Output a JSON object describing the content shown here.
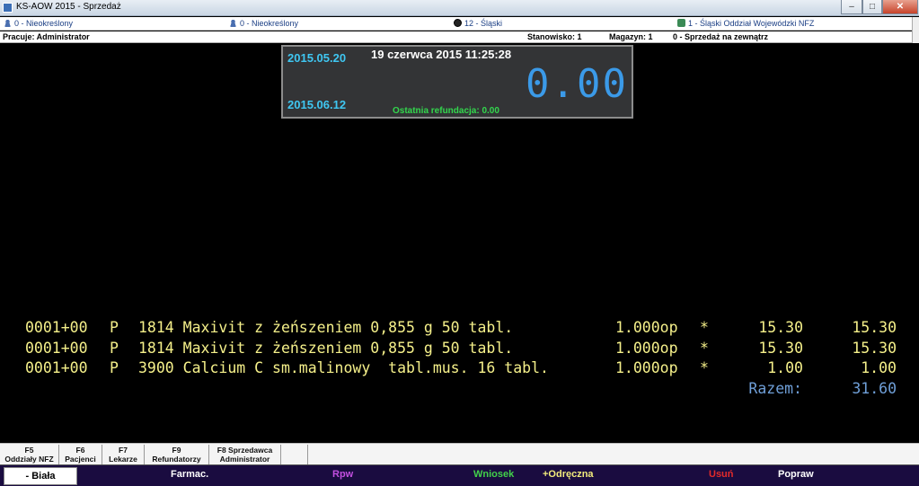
{
  "window": {
    "title": "KS-AOW 2015 - Sprzedaż",
    "minimize": "–",
    "maximize": "□",
    "close": "✕"
  },
  "info1": {
    "patient": "0 - Nieokreślony",
    "doctor": "0 - Nieokreślony",
    "branch": "12 - Śląski",
    "nfz": "1 - Śląski Oddział Wojewódzki NFZ"
  },
  "info2": {
    "operator": "Pracuje: Administrator",
    "station": "Stanowisko: 1",
    "warehouse": "Magazyn: 1",
    "sale_type": "0 - Sprzedaż na zewnątrz"
  },
  "clock": {
    "date_top": "2015.05.20",
    "date_bottom": "2015.06.12",
    "datetime": "19 czerwca 2015  11:25:28",
    "amount": "0.00",
    "last_refund": "Ostatnia refundacja: 0.00"
  },
  "items": [
    {
      "code": "0001+00",
      "flag": "P",
      "name": "1814 Maxivit z żeńszeniem 0,855 g 50 tabl.",
      "qty": "1.000op",
      "mark": "*",
      "price": "15.30",
      "total": "15.30"
    },
    {
      "code": "0001+00",
      "flag": "P",
      "name": "1814 Maxivit z żeńszeniem 0,855 g 50 tabl.",
      "qty": "1.000op",
      "mark": "*",
      "price": "15.30",
      "total": "15.30"
    },
    {
      "code": "0001+00",
      "flag": "P",
      "name": "3900 Calcium C sm.malinowy  tabl.mus. 16 tabl.",
      "qty": "1.000op",
      "mark": "*",
      "price": "1.00",
      "total": "1.00"
    }
  ],
  "summary": {
    "label": "Razem:",
    "value": "31.60"
  },
  "fkeys": [
    {
      "key": "F5",
      "label": "Oddziały NFZ"
    },
    {
      "key": "F6",
      "label": "Pacjenci"
    },
    {
      "key": "F7",
      "label": "Lekarze"
    },
    {
      "key": "F9",
      "label": "Refundatorzy"
    },
    {
      "key": "F8 Sprzedawca",
      "label": "Administrator"
    }
  ],
  "bottom": {
    "biala": "- Biała",
    "farmac": "Farmac.",
    "rpw": "Rpw",
    "wniosek": "Wniosek",
    "odreczna": "+Odręczna",
    "usun": "Usuń",
    "popraw": "Popraw"
  },
  "colors": {
    "rpw": "#c24fe0",
    "wniosek": "#42d24a",
    "odreczna": "#f2ec7c",
    "usun": "#e42a2a",
    "popraw": "#ffffff",
    "farmac": "#ffffff"
  }
}
